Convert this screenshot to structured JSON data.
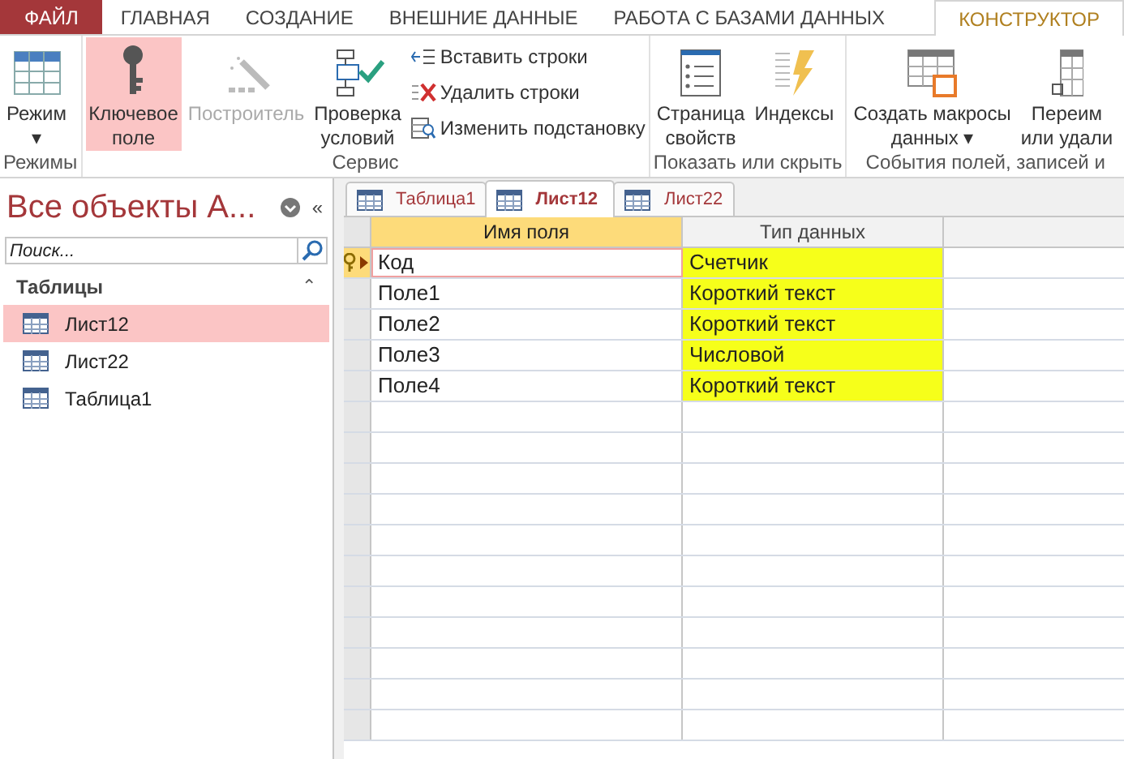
{
  "ribbon_tabs": [
    {
      "label": "ФАЙЛ",
      "kind": "file",
      "selected": false
    },
    {
      "label": "ГЛАВНАЯ",
      "kind": "tab",
      "selected": false
    },
    {
      "label": "СОЗДАНИЕ",
      "kind": "tab",
      "selected": false
    },
    {
      "label": "ВНЕШНИЕ ДАННЫЕ",
      "kind": "tab",
      "selected": false
    },
    {
      "label": "РАБОТА С БАЗАМИ ДАННЫХ",
      "kind": "tab",
      "selected": false
    },
    {
      "label": "КОНСТРУКТОР",
      "kind": "tab",
      "selected": true
    }
  ],
  "ribbon_groups": [
    {
      "label": "Режимы",
      "items": [
        {
          "kind": "large",
          "lines": [
            "Режим",
            "▾"
          ],
          "selected": false,
          "disabled": false
        }
      ]
    },
    {
      "label": "Сервис",
      "items": [
        {
          "kind": "large",
          "lines": [
            "Ключевое",
            "поле"
          ],
          "selected": true,
          "disabled": false
        },
        {
          "kind": "large",
          "lines": [
            "Построитель"
          ],
          "selected": false,
          "disabled": true
        },
        {
          "kind": "large",
          "lines": [
            "Проверка",
            "условий"
          ],
          "selected": false,
          "disabled": false
        },
        {
          "kind": "small_stack",
          "buttons": [
            {
              "label": "Вставить строки"
            },
            {
              "label": "Удалить строки"
            },
            {
              "label": "Изменить подстановку"
            }
          ]
        }
      ]
    },
    {
      "label": "Показать или скрыть",
      "items": [
        {
          "kind": "large",
          "lines": [
            "Страница",
            "свойств"
          ],
          "selected": false,
          "disabled": false
        },
        {
          "kind": "large",
          "lines": [
            "Индексы"
          ],
          "selected": false,
          "disabled": false
        }
      ]
    },
    {
      "label": "События полей, записей и",
      "items": [
        {
          "kind": "large",
          "lines": [
            "Создать макросы",
            "данных ▾"
          ],
          "selected": false,
          "disabled": false
        },
        {
          "kind": "large",
          "lines": [
            "Переим",
            "или удали"
          ],
          "selected": false,
          "disabled": false
        }
      ]
    }
  ],
  "nav_pane": {
    "title": "Все объекты А...",
    "collapse_glyph": "«",
    "search": {
      "placeholder": "Поиск..."
    },
    "section": "Таблицы",
    "section_glyph": "⌃",
    "items": [
      {
        "label": "Лист12",
        "selected": true
      },
      {
        "label": "Лист22",
        "selected": false
      },
      {
        "label": "Таблица1",
        "selected": false
      }
    ]
  },
  "doc_tabs": [
    {
      "label": "Таблица1",
      "selected": false
    },
    {
      "label": "Лист12",
      "selected": true
    },
    {
      "label": "Лист22",
      "selected": false
    }
  ],
  "table": {
    "columns": [
      "Имя поля",
      "Тип данных"
    ],
    "rows": [
      {
        "field": "Код",
        "type": "Счетчик",
        "primary_key": true,
        "selected": true,
        "highlighted": true
      },
      {
        "field": "Поле1",
        "type": "Короткий текст",
        "primary_key": false,
        "selected": false,
        "highlighted": true
      },
      {
        "field": "Поле2",
        "type": "Короткий текст",
        "primary_key": false,
        "selected": false,
        "highlighted": true
      },
      {
        "field": "Поле3",
        "type": "Числовой",
        "primary_key": false,
        "selected": false,
        "highlighted": true
      },
      {
        "field": "Поле4",
        "type": "Короткий текст",
        "primary_key": false,
        "selected": false,
        "highlighted": true
      }
    ]
  }
}
